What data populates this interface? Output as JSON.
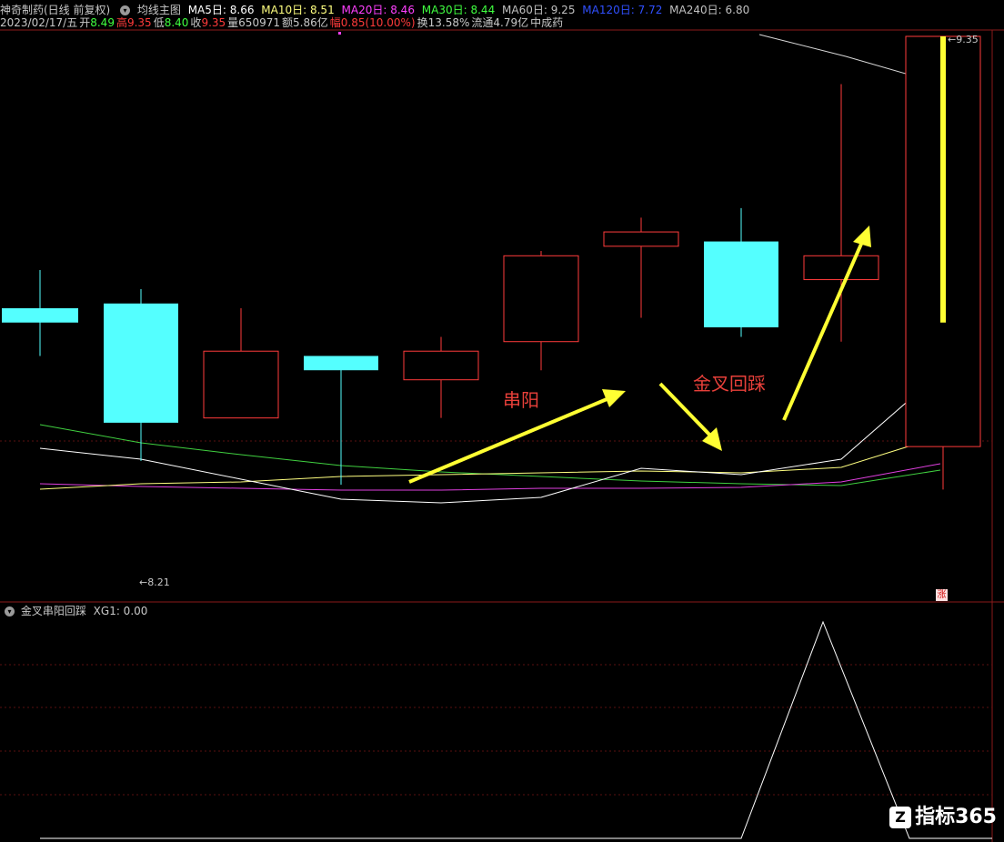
{
  "header": {
    "title": "神奇制药(日线 前复权)",
    "ma_label": "均线主图",
    "ma5": "MA5日: 8.66",
    "ma10": "MA10日: 8.51",
    "ma20": "MA20日: 8.46",
    "ma30": "MA30日: 8.44",
    "ma60": "MA60日: 9.25",
    "ma120": "MA120日: 7.72",
    "ma240": "MA240日: 6.80"
  },
  "quote": {
    "date": "2023/02/17/五",
    "open_label": "开",
    "open": "8.49",
    "high_label": "高",
    "high": "9.35",
    "low_label": "低",
    "low": "8.40",
    "close_label": "收",
    "close": "9.35",
    "vol_label": "量",
    "vol": "650971",
    "amt_label": "额",
    "amt": "5.86亿",
    "chg_label": "幅",
    "chg": "0.85(10.00%)",
    "turn_label": "换",
    "turn": "13.58%",
    "float_label": "流通",
    "float": "4.79亿",
    "sector": "中成药"
  },
  "annotations": {
    "chuanyang": "串阳",
    "jinchahuicai": "金叉回踩",
    "high_price": "9.35",
    "low_price": "8.21",
    "zhang": "涨"
  },
  "indicator": {
    "title": "金叉串阳回踩",
    "xg": "XG1: 0.00"
  },
  "watermark": {
    "icon": "Z",
    "text": "指标365"
  },
  "colors": {
    "up": "#ff3b3b",
    "down": "#54ffff",
    "ma5": "#ffffff",
    "ma10": "#ffff80",
    "ma20": "#ff40ff",
    "ma30": "#40ff40",
    "ma60": "#c0c0c0",
    "ma120": "#4060ff",
    "arrow": "#ffff33"
  },
  "chart_data": {
    "type": "candlestick",
    "title": "神奇制药(日线 前复权)",
    "candles": [
      {
        "direction": "down",
        "open": 8.78,
        "close": 8.75,
        "high": 8.86,
        "low": 8.68
      },
      {
        "direction": "down",
        "open": 8.79,
        "close": 8.54,
        "high": 8.82,
        "low": 8.46
      },
      {
        "direction": "up",
        "open": 8.55,
        "close": 8.69,
        "high": 8.78,
        "low": 8.55
      },
      {
        "direction": "down",
        "open": 8.68,
        "close": 8.65,
        "high": 8.68,
        "low": 8.41
      },
      {
        "direction": "up",
        "open": 8.63,
        "close": 8.69,
        "high": 8.72,
        "low": 8.55
      },
      {
        "direction": "up",
        "open": 8.71,
        "close": 8.89,
        "high": 8.9,
        "low": 8.65
      },
      {
        "direction": "up",
        "open": 8.91,
        "close": 8.94,
        "high": 8.97,
        "low": 8.76
      },
      {
        "direction": "down",
        "open": 8.92,
        "close": 8.74,
        "high": 8.99,
        "low": 8.72
      },
      {
        "direction": "up",
        "open": 8.84,
        "close": 8.89,
        "high": 9.25,
        "low": 8.71
      },
      {
        "direction": "up",
        "open": 8.49,
        "close": 9.35,
        "high": 9.35,
        "low": 8.4
      }
    ],
    "indicator_series": {
      "name": "XG1",
      "values": [
        0,
        0,
        0,
        0,
        0,
        0,
        0,
        0,
        1,
        0,
        0
      ]
    }
  }
}
